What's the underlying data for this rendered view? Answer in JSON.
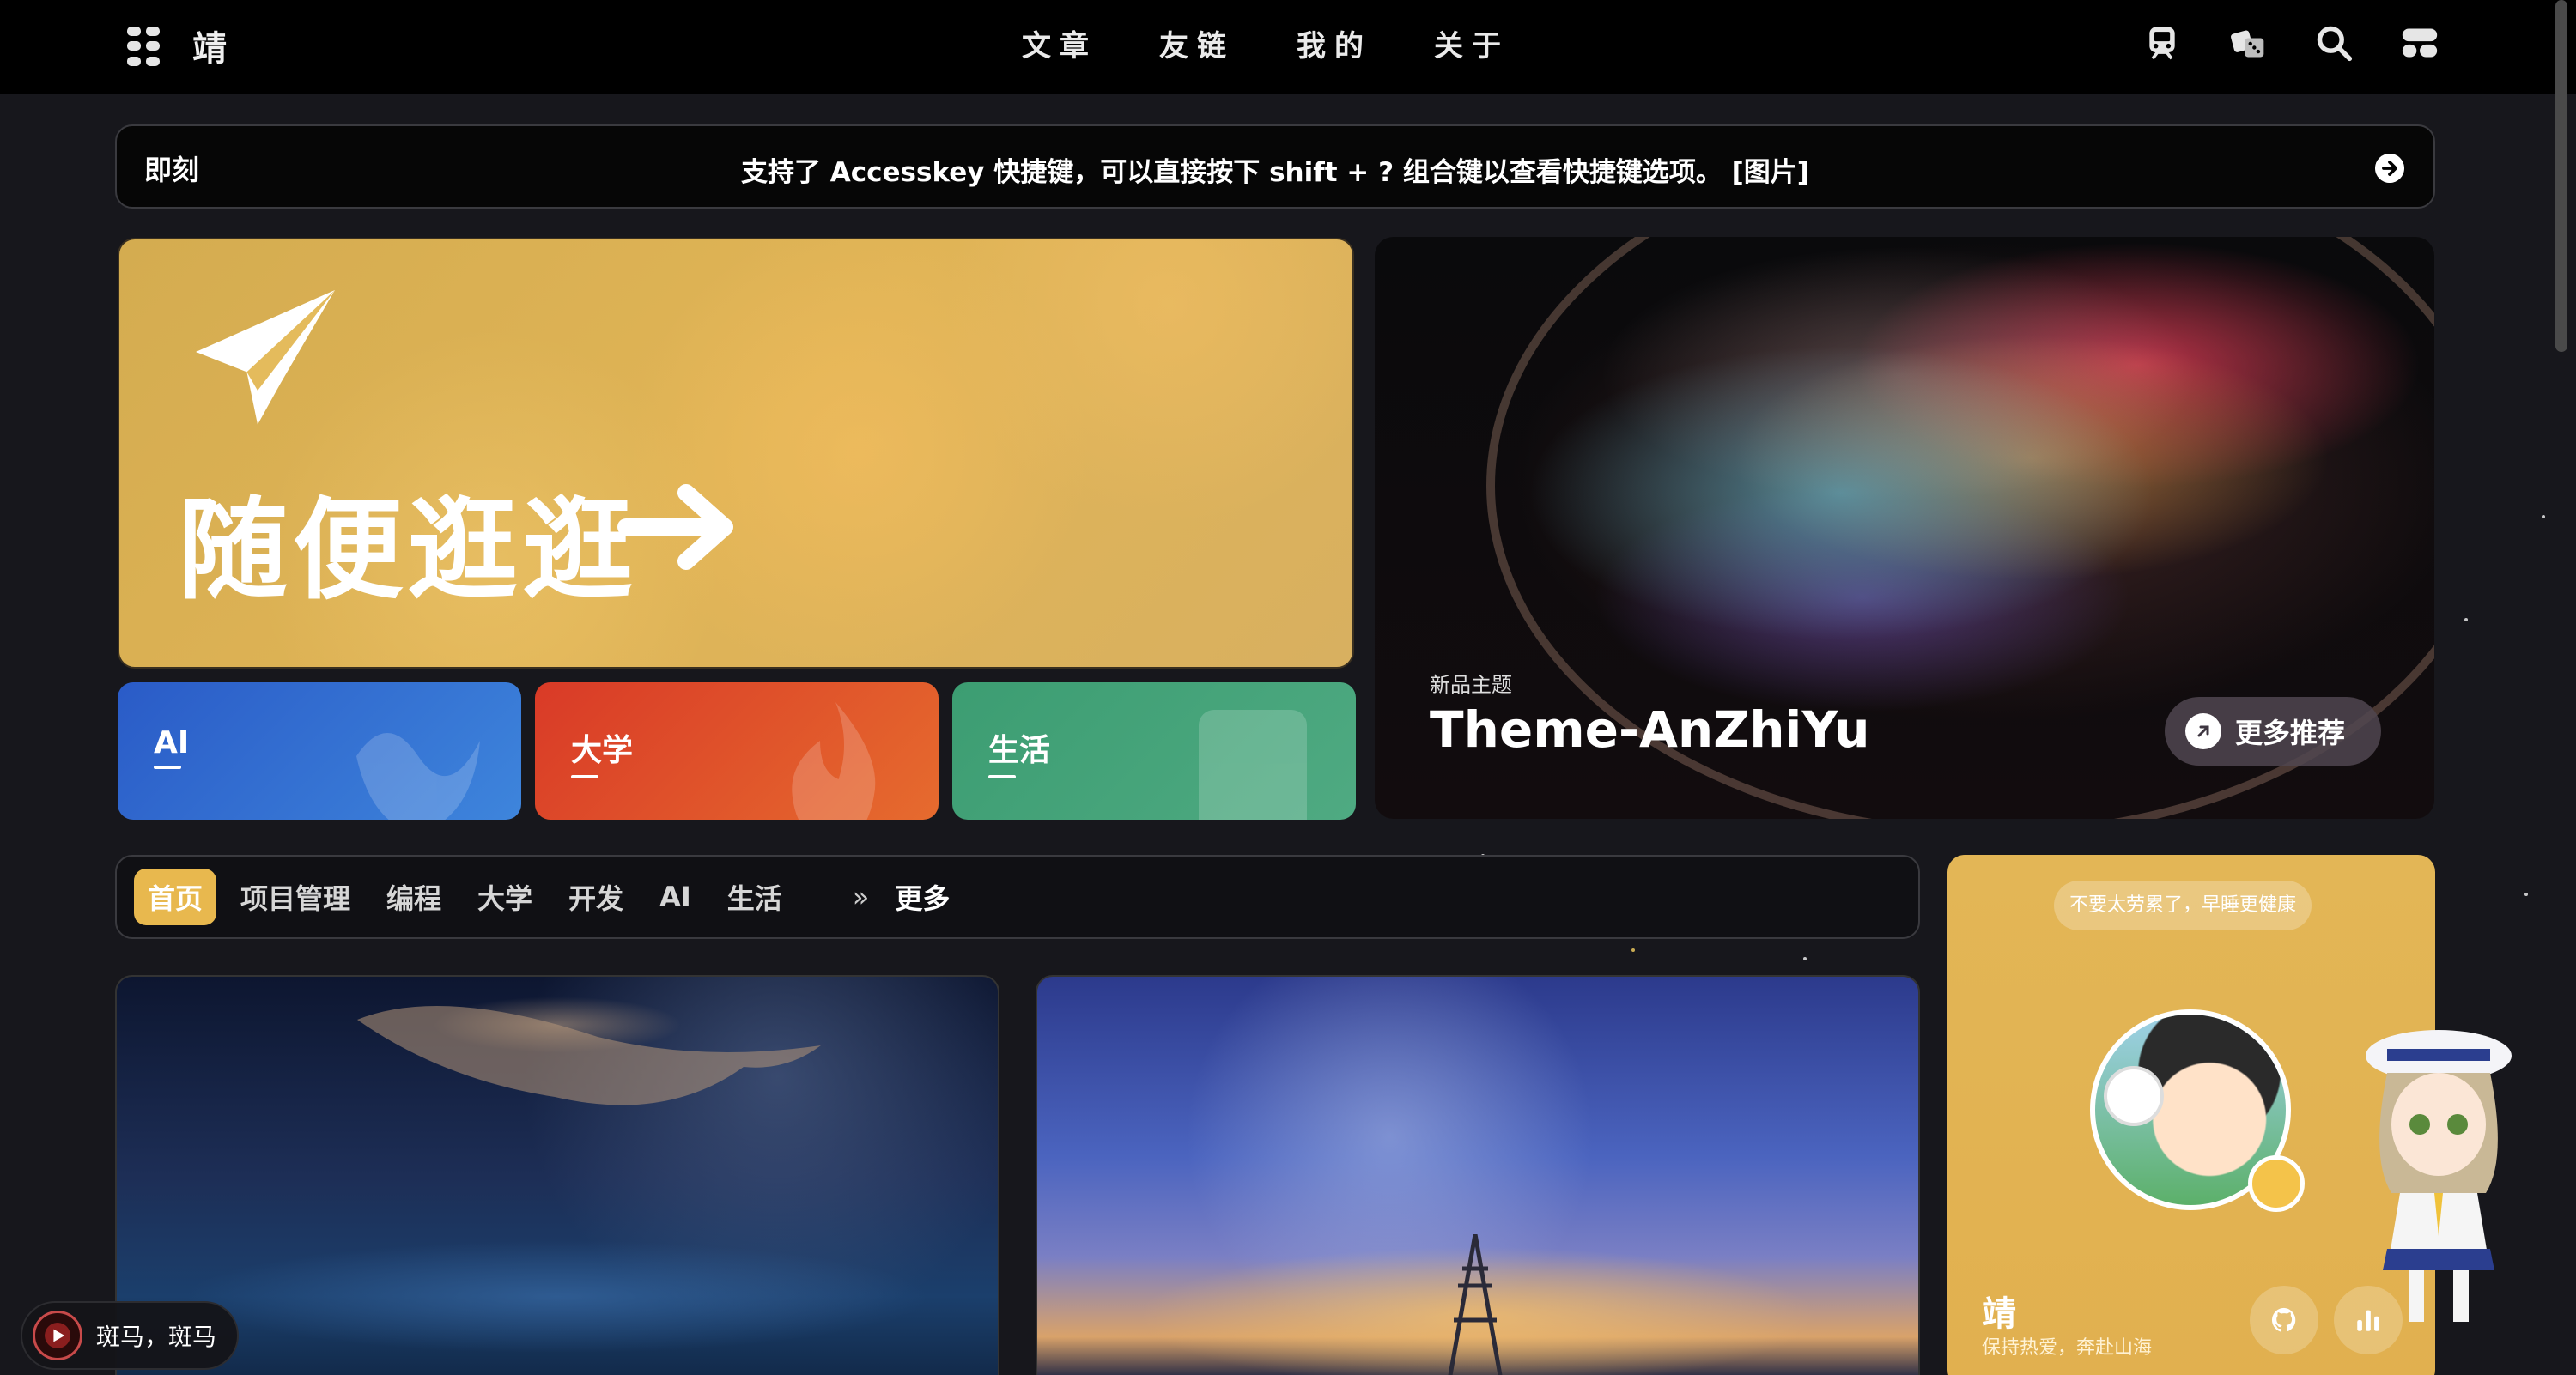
{
  "nav": {
    "logo": "靖",
    "menu": [
      "文章",
      "友链",
      "我的",
      "关于"
    ],
    "icons": [
      "train-icon",
      "dice-icon",
      "search-icon",
      "console-icon"
    ]
  },
  "moment": {
    "tag": "即刻",
    "message": "支持了 Accesskey 快捷键，可以直接按下 shift + ? 组合键以查看快捷键选项。 [图片]"
  },
  "random_card": {
    "title": "随便逛逛"
  },
  "categories": [
    {
      "label": "AI",
      "color": "#2a5bc7"
    },
    {
      "label": "大学",
      "color": "#d93a27"
    },
    {
      "label": "生活",
      "color": "#3c9d72"
    }
  ],
  "theme_card": {
    "subtitle": "新品主题",
    "name": "Theme-AnZhiYu",
    "more_label": "更多推荐"
  },
  "tabs": {
    "items": [
      "首页",
      "项目管理",
      "编程",
      "大学",
      "开发",
      "AI",
      "生活"
    ],
    "active": "首页",
    "more_label": "更多"
  },
  "profile": {
    "bubble": "不要太劳累了，早睡更健康",
    "name": "靖",
    "motto": "保持热爱，奔赴山海"
  },
  "player": {
    "song": "斑马，斑马"
  },
  "colors": {
    "accent": "#e8b84e",
    "background": "#17171c"
  }
}
